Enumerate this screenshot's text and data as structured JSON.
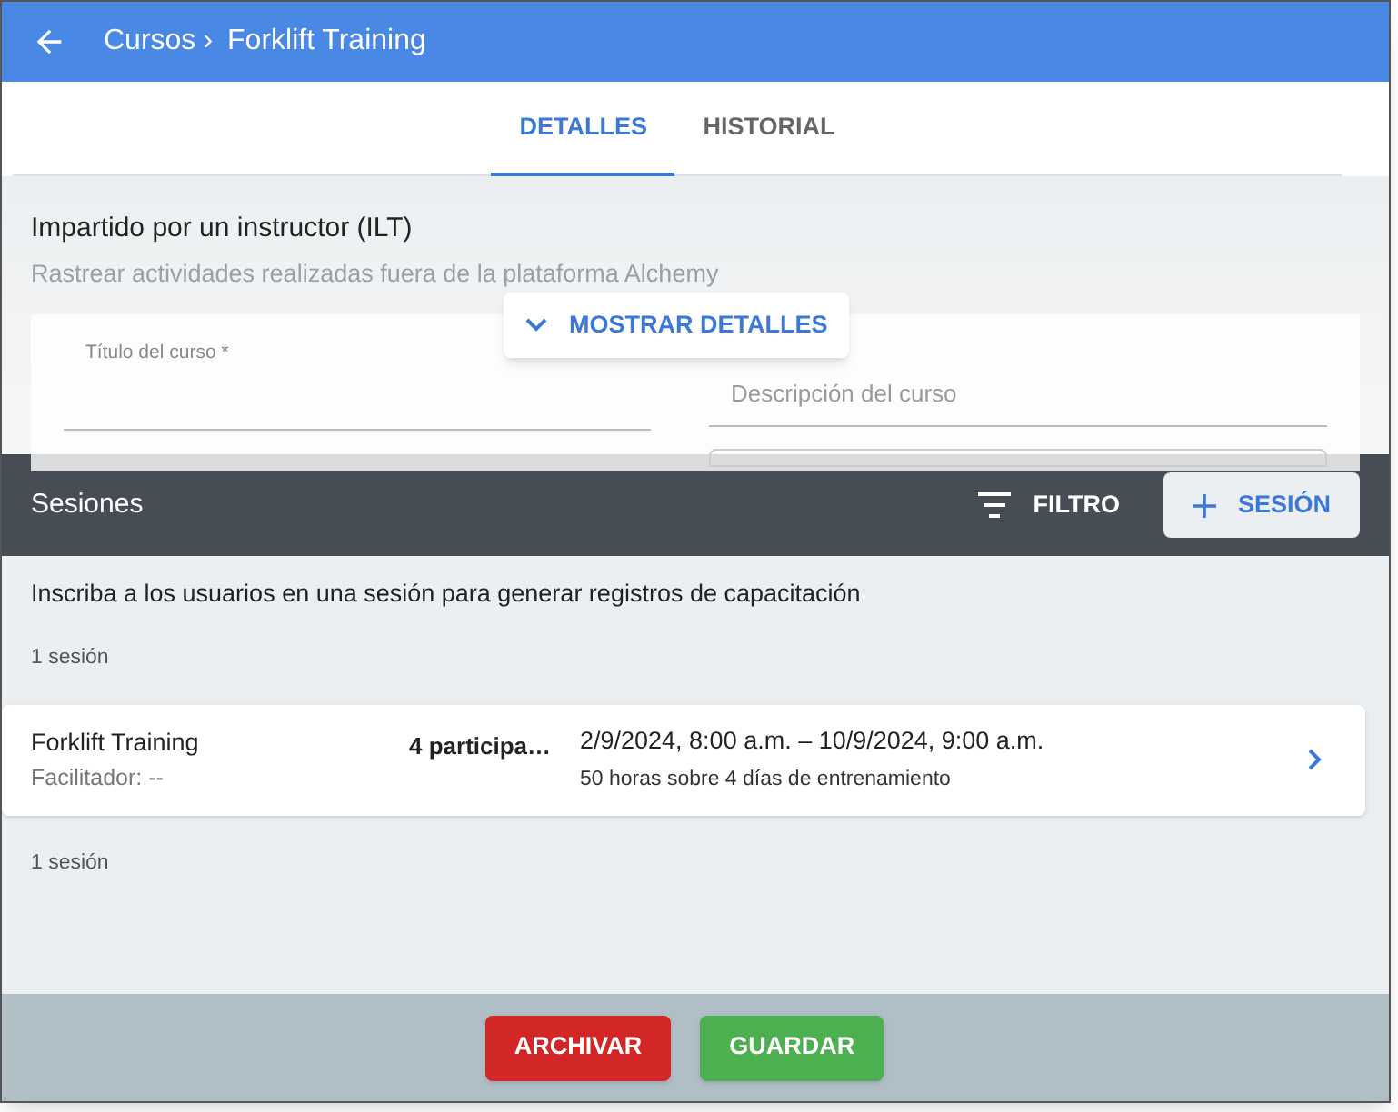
{
  "header": {
    "breadcrumb": "Cursos",
    "separator": "›",
    "title": "Forklift Training"
  },
  "tabs": [
    {
      "label": "DETALLES",
      "selected": true
    },
    {
      "label": "HISTORIAL",
      "selected": false
    }
  ],
  "course": {
    "heading": "Impartido por un instructor (ILT)",
    "subtitle": "Rastrear actividades realizadas fuera de la plataforma Alchemy",
    "show_details": "MOSTRAR DETALLES",
    "title_field": {
      "label": "Título del curso *"
    },
    "description_field": {
      "placeholder": "Descripción del curso"
    }
  },
  "sessions": {
    "title": "Sesiones",
    "filter": "FILTRO",
    "add": "SESIÓN",
    "intro": "Inscriba a los usuarios en una sesión para generar registros de capacitación",
    "count_top": "1 sesión",
    "items": [
      {
        "name": "Forklift Training",
        "facilitator": "Facilitador: --",
        "participants": "4 participa…",
        "dates": "2/9/2024, 8:00 a.m. – 10/9/2024, 9:00 a.m.",
        "summary": "50 horas sobre 4 días de entrenamiento"
      }
    ],
    "count_bottom": "1 sesión"
  },
  "footer": {
    "buttons": [
      {
        "label": "ARCHIVAR",
        "kind": "danger"
      },
      {
        "label": "GUARDAR",
        "kind": "primary"
      }
    ]
  }
}
